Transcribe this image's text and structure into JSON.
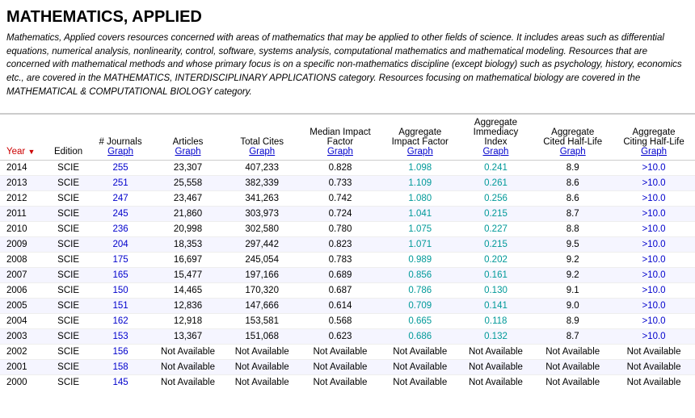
{
  "header": {
    "title": "MATHEMATICS, APPLIED",
    "description": "Mathematics, Applied covers resources concerned with areas of mathematics that may be applied to other fields of science. It includes areas such as differential equations, numerical analysis, nonlinearity, control, software, systems analysis, computational mathematics and mathematical modeling. Resources that are concerned with mathematical methods and whose primary focus is on a specific non-mathematics discipline (except biology) such as psychology, history, economics etc., are covered in the MATHEMATICS, INTERDISCIPLINARY APPLICATIONS category. Resources focusing on mathematical biology are covered in the MATHEMATICAL & COMPUTATIONAL BIOLOGY category."
  },
  "table": {
    "columns": [
      {
        "id": "year",
        "label": "Year",
        "sublink": null,
        "sortable": true
      },
      {
        "id": "edition",
        "label": "Edition",
        "sublink": null
      },
      {
        "id": "journals",
        "label": "# Journals",
        "sublink": "Graph"
      },
      {
        "id": "articles",
        "label": "Articles",
        "sublink": "Graph"
      },
      {
        "id": "totalCites",
        "label": "Total Cites",
        "sublink": "Graph"
      },
      {
        "id": "medianIF",
        "label": "Median Impact Factor",
        "sublink": "Graph"
      },
      {
        "id": "aggregateIF",
        "label": "Aggregate Impact Factor",
        "sublink": "Graph"
      },
      {
        "id": "aggregateImm",
        "label": "Aggregate Immediacy Index",
        "sublink": "Graph"
      },
      {
        "id": "aggregateCitedHL",
        "label": "Aggregate Cited Half-Life",
        "sublink": "Graph"
      },
      {
        "id": "aggregateCitingHL",
        "label": "Aggregate Citing Half-Life",
        "sublink": "Graph"
      }
    ],
    "rows": [
      {
        "year": "2014",
        "edition": "SCIE",
        "journals": "255",
        "articles": "23,307",
        "totalCites": "407,233",
        "medianIF": "0.828",
        "aggregateIF": "1.098",
        "aggregateImm": "0.241",
        "aggregateCitedHL": "8.9",
        "aggregateCitingHL": ">10.0"
      },
      {
        "year": "2013",
        "edition": "SCIE",
        "journals": "251",
        "articles": "25,558",
        "totalCites": "382,339",
        "medianIF": "0.733",
        "aggregateIF": "1.109",
        "aggregateImm": "0.261",
        "aggregateCitedHL": "8.6",
        "aggregateCitingHL": ">10.0"
      },
      {
        "year": "2012",
        "edition": "SCIE",
        "journals": "247",
        "articles": "23,467",
        "totalCites": "341,263",
        "medianIF": "0.742",
        "aggregateIF": "1.080",
        "aggregateImm": "0.256",
        "aggregateCitedHL": "8.6",
        "aggregateCitingHL": ">10.0"
      },
      {
        "year": "2011",
        "edition": "SCIE",
        "journals": "245",
        "articles": "21,860",
        "totalCites": "303,973",
        "medianIF": "0.724",
        "aggregateIF": "1.041",
        "aggregateImm": "0.215",
        "aggregateCitedHL": "8.7",
        "aggregateCitingHL": ">10.0"
      },
      {
        "year": "2010",
        "edition": "SCIE",
        "journals": "236",
        "articles": "20,998",
        "totalCites": "302,580",
        "medianIF": "0.780",
        "aggregateIF": "1.075",
        "aggregateImm": "0.227",
        "aggregateCitedHL": "8.8",
        "aggregateCitingHL": ">10.0"
      },
      {
        "year": "2009",
        "edition": "SCIE",
        "journals": "204",
        "articles": "18,353",
        "totalCites": "297,442",
        "medianIF": "0.823",
        "aggregateIF": "1.071",
        "aggregateImm": "0.215",
        "aggregateCitedHL": "9.5",
        "aggregateCitingHL": ">10.0"
      },
      {
        "year": "2008",
        "edition": "SCIE",
        "journals": "175",
        "articles": "16,697",
        "totalCites": "245,054",
        "medianIF": "0.783",
        "aggregateIF": "0.989",
        "aggregateImm": "0.202",
        "aggregateCitedHL": "9.2",
        "aggregateCitingHL": ">10.0"
      },
      {
        "year": "2007",
        "edition": "SCIE",
        "journals": "165",
        "articles": "15,477",
        "totalCites": "197,166",
        "medianIF": "0.689",
        "aggregateIF": "0.856",
        "aggregateImm": "0.161",
        "aggregateCitedHL": "9.2",
        "aggregateCitingHL": ">10.0"
      },
      {
        "year": "2006",
        "edition": "SCIE",
        "journals": "150",
        "articles": "14,465",
        "totalCites": "170,320",
        "medianIF": "0.687",
        "aggregateIF": "0.786",
        "aggregateImm": "0.130",
        "aggregateCitedHL": "9.1",
        "aggregateCitingHL": ">10.0"
      },
      {
        "year": "2005",
        "edition": "SCIE",
        "journals": "151",
        "articles": "12,836",
        "totalCites": "147,666",
        "medianIF": "0.614",
        "aggregateIF": "0.709",
        "aggregateImm": "0.141",
        "aggregateCitedHL": "9.0",
        "aggregateCitingHL": ">10.0"
      },
      {
        "year": "2004",
        "edition": "SCIE",
        "journals": "162",
        "articles": "12,918",
        "totalCites": "153,581",
        "medianIF": "0.568",
        "aggregateIF": "0.665",
        "aggregateImm": "0.118",
        "aggregateCitedHL": "8.9",
        "aggregateCitingHL": ">10.0"
      },
      {
        "year": "2003",
        "edition": "SCIE",
        "journals": "153",
        "articles": "13,367",
        "totalCites": "151,068",
        "medianIF": "0.623",
        "aggregateIF": "0.686",
        "aggregateImm": "0.132",
        "aggregateCitedHL": "8.7",
        "aggregateCitingHL": ">10.0"
      },
      {
        "year": "2002",
        "edition": "SCIE",
        "journals": "156",
        "articles": "Not Available",
        "totalCites": "Not Available",
        "medianIF": "Not Available",
        "aggregateIF": "Not Available",
        "aggregateImm": "Not Available",
        "aggregateCitedHL": "Not Available",
        "aggregateCitingHL": "Not Available"
      },
      {
        "year": "2001",
        "edition": "SCIE",
        "journals": "158",
        "articles": "Not Available",
        "totalCites": "Not Available",
        "medianIF": "Not Available",
        "aggregateIF": "Not Available",
        "aggregateImm": "Not Available",
        "aggregateCitedHL": "Not Available",
        "aggregateCitingHL": "Not Available"
      },
      {
        "year": "2000",
        "edition": "SCIE",
        "journals": "145",
        "articles": "Not Available",
        "totalCites": "Not Available",
        "medianIF": "Not Available",
        "aggregateIF": "Not Available",
        "aggregateImm": "Not Available",
        "aggregateCitedHL": "Not Available",
        "aggregateCitingHL": "Not Available"
      }
    ]
  }
}
